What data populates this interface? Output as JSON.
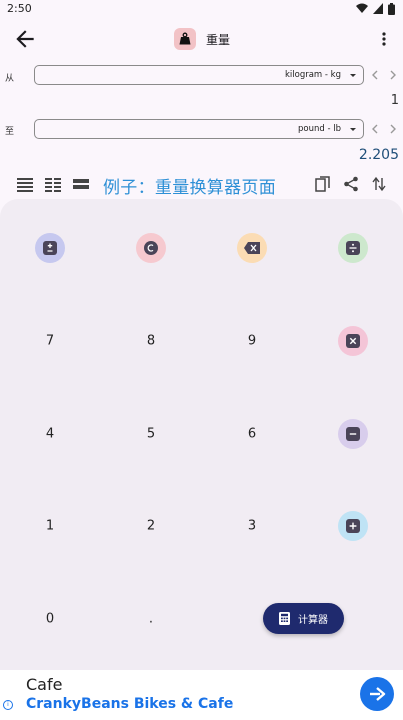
{
  "status_bar": {
    "time": "2:50"
  },
  "header": {
    "title": "重量"
  },
  "from": {
    "label": "从",
    "unit": "kilogram - kg",
    "value": "1"
  },
  "to": {
    "label": "至",
    "unit": "pound - lb",
    "value": "2.205"
  },
  "caption": "例子：重量换算器页面",
  "keypad": {
    "digits": [
      "7",
      "8",
      "9",
      "4",
      "5",
      "6",
      "1",
      "2",
      "3",
      "0",
      "."
    ]
  },
  "fab": {
    "label": "计算器"
  },
  "ad": {
    "title": "Cafe",
    "subtitle": "CrankyBeans Bikes & Cafe",
    "info": "i"
  },
  "colors": {
    "plus_minus": "#c6c8ef",
    "clear": "#f6c9cf",
    "backspace": "#fbdcb4",
    "divide": "#cde8cd",
    "multiply": "#f4c5d7",
    "minus": "#d8cdec",
    "plus": "#bfe3f5",
    "fab": "#1f2a6e",
    "caption": "#2e90d6"
  },
  "icons": [
    "back-arrow-icon",
    "weight-icon",
    "more-vert-icon",
    "chevron-left-icon",
    "chevron-right-icon",
    "list-view-icon",
    "grid-view-icon",
    "single-view-icon",
    "copy-icon",
    "share-icon",
    "swap-icon",
    "plus-minus-icon",
    "clear-icon",
    "backspace-icon",
    "divide-icon",
    "multiply-icon",
    "minus-icon",
    "plus-icon",
    "calculator-icon",
    "directions-icon"
  ]
}
